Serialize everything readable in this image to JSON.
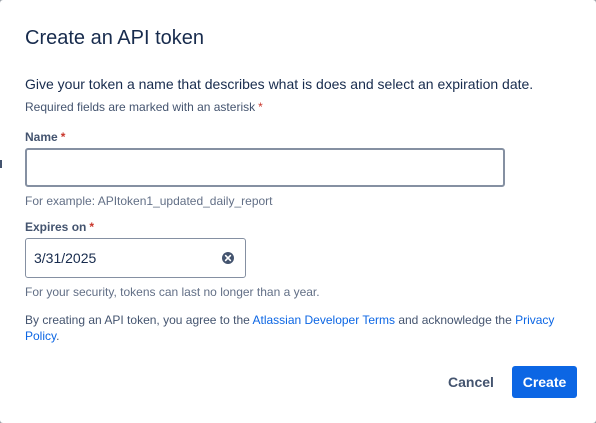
{
  "dialog": {
    "title": "Create an API token",
    "description": "Give your token a name that describes what is does and select an expiration date.",
    "required_note": "Required fields are marked with an asterisk",
    "asterisk": "*"
  },
  "name_field": {
    "label": "Name",
    "value": "",
    "placeholder": "",
    "helper": "For example: APItoken1_updated_daily_report"
  },
  "expires_field": {
    "label": "Expires on",
    "value": "3/31/2025",
    "helper": "For your security, tokens can last no longer than a year.",
    "clear_icon": "clear-circle-x-icon"
  },
  "agreement": {
    "prefix": "By creating an API token, you agree to the ",
    "terms_link": "Atlassian Developer Terms",
    "middle": " and acknowledge the ",
    "privacy_link": "Privacy Policy",
    "suffix": "."
  },
  "actions": {
    "cancel_label": "Cancel",
    "create_label": "Create"
  },
  "colors": {
    "primary": "#0c66e4",
    "text": "#172b4d",
    "subtle_text": "#44546f",
    "required": "#c9372c"
  }
}
